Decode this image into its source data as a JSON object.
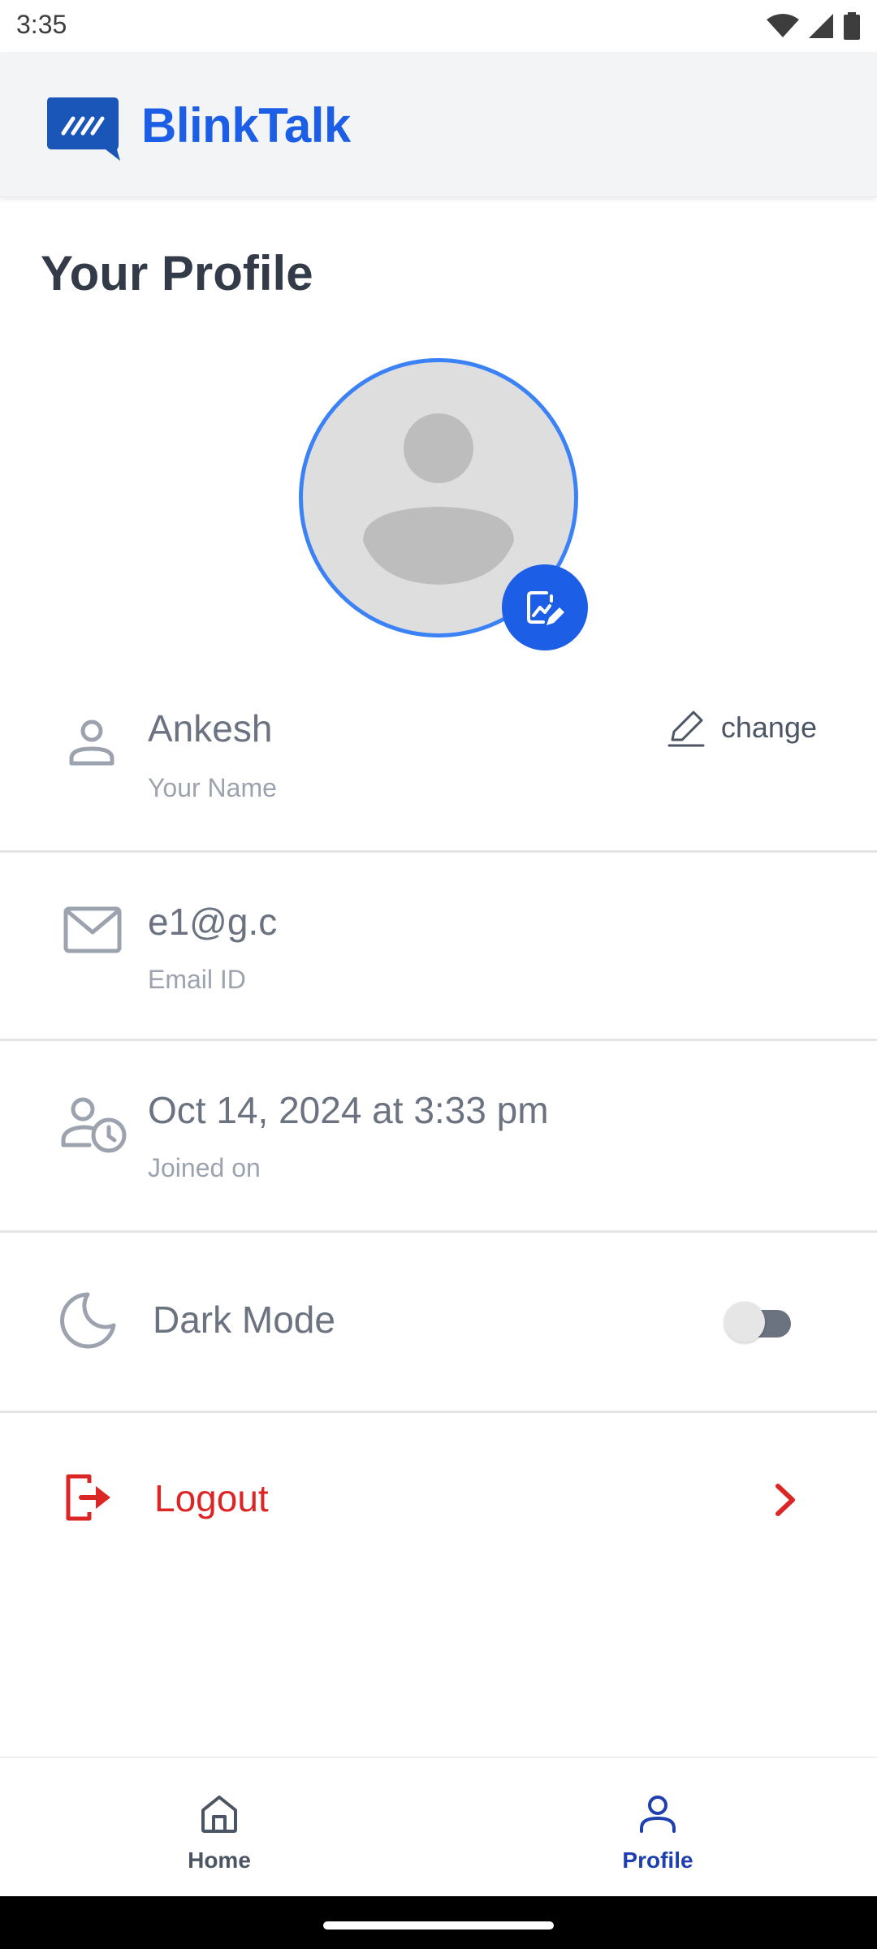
{
  "status_bar": {
    "time": "3:35"
  },
  "header": {
    "brand": "BlinkTalk"
  },
  "page": {
    "title": "Your Profile"
  },
  "profile": {
    "name": "Ankesh",
    "name_label": "Your Name",
    "change_label": "change",
    "email": "e1@g.c",
    "email_label": "Email ID",
    "joined": "Oct 14, 2024 at 3:33 pm",
    "joined_label": "Joined on"
  },
  "settings": {
    "dark_mode_label": "Dark Mode",
    "dark_mode_enabled": false,
    "logout_label": "Logout"
  },
  "nav": {
    "items": [
      {
        "label": "Home",
        "icon": "home-icon",
        "active": false
      },
      {
        "label": "Profile",
        "icon": "person-icon",
        "active": true
      }
    ]
  },
  "colors": {
    "brand": "#1d5ee6",
    "accent": "#3b82f6",
    "danger": "#dc2626",
    "text_primary": "#6b7280",
    "text_secondary": "#9ca3af",
    "title": "#333b48",
    "nav_active": "#1e40af",
    "nav_inactive": "#4b5563"
  }
}
